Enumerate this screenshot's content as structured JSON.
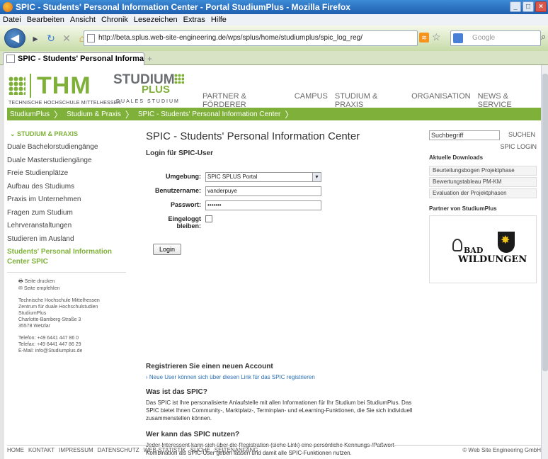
{
  "window": {
    "title": "SPIC - Students' Personal Information Center - Portal StudiumPlus - Mozilla Firefox",
    "buttons": [
      "_",
      "□",
      "×"
    ]
  },
  "menubar": [
    "Datei",
    "Bearbeiten",
    "Ansicht",
    "Chronik",
    "Lesezeichen",
    "Extras",
    "Hilfe"
  ],
  "toolbar": {
    "url": "http://beta.splus.web-site-engineering.de/wps/splus/home/studiumplus/spic_log_reg/",
    "search_placeholder": "Google"
  },
  "tab": {
    "label": "SPIC - Students' Personal Informatio...",
    "new_tab": "+"
  },
  "header": {
    "thm": "THM",
    "thm_sub": "TECHNISCHE HOCHSCHULE MITTELHESSEN",
    "sp_studium": "STUDIUM",
    "sp_plus": "PLUS",
    "sp_dual": "DUALES STUDIUM",
    "nav": [
      "PARTNER & FÖRDERER",
      "CAMPUS",
      "STUDIUM & PRAXIS",
      "ORGANISATION",
      "NEWS & SERVICE"
    ]
  },
  "breadcrumb": [
    "StudiumPlus",
    "Studium & Praxis",
    "SPIC - Students' Personal Information Center"
  ],
  "leftnav": {
    "section": "STUDIUM & PRAXIS",
    "items": [
      "Duale Bachelorstudiengänge",
      "Duale Masterstudiengänge",
      "Freie Studienplätze",
      "Aufbau des Studiums",
      "Praxis im Unternehmen",
      "Fragen zum Studium",
      "Lehrveranstaltungen",
      "Studieren im Ausland"
    ],
    "active": "Students' Personal Information Center SPIC",
    "print": "Seite drucken",
    "recommend": "Seite empfehlen",
    "address": [
      "Technische Hochschule Mittelhessen",
      "Zentrum für duale Hochschulstudien",
      "StudiumPlus",
      "Charlotte-Bamberg-Straße 3",
      "35578 Wetzlar"
    ],
    "contact": [
      "Telefon: +49 6441 447 86 0",
      "Telefax: +49 6441 447 86 29",
      "E-Mail: info@Studiumplus.de"
    ]
  },
  "main": {
    "title": "SPIC - Students' Personal Information Center",
    "login_heading": "Login für SPIC-User",
    "fields": {
      "umgebung_label": "Umgebung:",
      "umgebung_value": "SPIC SPLUS Portal",
      "user_label": "Benutzername:",
      "user_value": "vanderpuye",
      "pass_label": "Passwort:",
      "pass_value": "•••••••",
      "stay_label": "Eingeloggt bleiben:"
    },
    "login_button": "Login",
    "register_heading": "Registrieren Sie einen neuen Account",
    "register_link": "› Neue User können sich über diesen Link für das SPIC registrieren",
    "what_heading": "Was ist das SPIC?",
    "what_text": "Das SPIC ist Ihre personalisierte Anlaufstelle mit allen Informationen für Ihr Studium bei StudiumPlus. Das SPIC bietet Ihnen Community-, Marktplatz-, Terminplan- und eLearning-Funktionen, die Sie sich individuell zusammenstellen können.",
    "who_heading": "Wer kann das SPIC nutzen?",
    "who_text": "Jeder Interessent kann sich über die Registration (siehe Link) eine persönliche Kennungs-/Paßwort-Kombination als SPIC-User geben lassen und damit alle SPIC-Funktionen nutzen."
  },
  "right": {
    "search_value": "Suchbegriff",
    "search_button": "SUCHEN",
    "spic_login": "SPIC LOGIN",
    "downloads_heading": "Aktuelle Downloads",
    "downloads": [
      "Beurteilungsbogen Projektphase",
      "Bewertungstableau PM-KM",
      "Evaluation der Projektphasen"
    ],
    "partner_heading": "Partner von StudiumPlus",
    "partner_logo_line1": "BAD",
    "partner_logo_line2": "WILDUNGEN"
  },
  "footer": {
    "links": [
      "HOME",
      "KONTAKT",
      "IMPRESSUM",
      "DATENSCHUTZ",
      "WEB-STATISTIK",
      "SUCHE",
      "SEITENANFANG"
    ],
    "copyright": "© Web Site Engineering GmbH"
  },
  "colors": {
    "brand_green": "#7fb13a",
    "link_blue": "#2a6fb3"
  }
}
